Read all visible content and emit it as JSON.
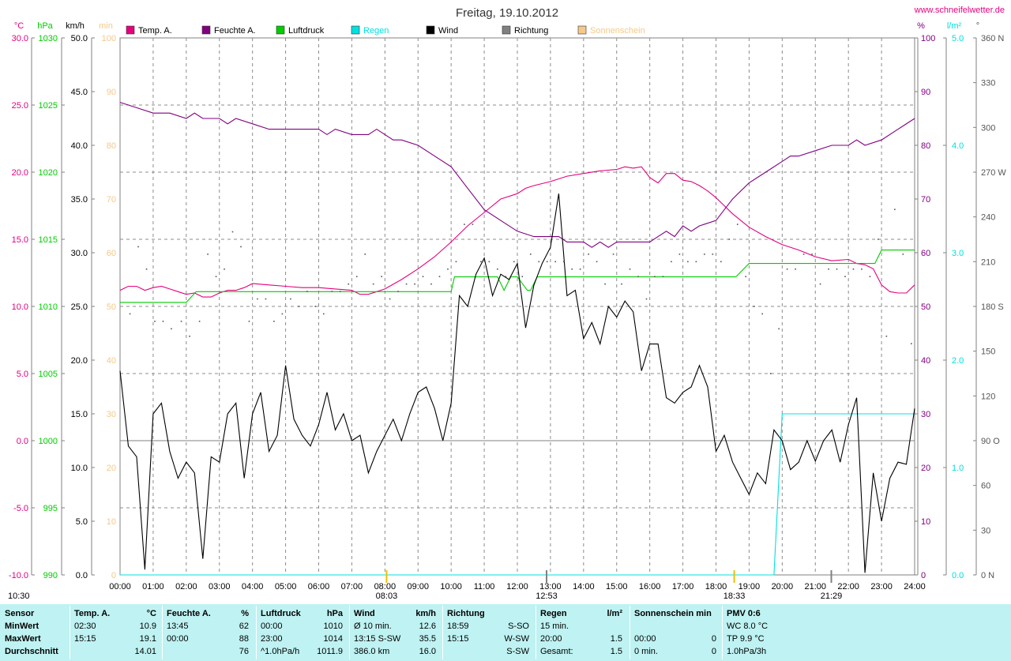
{
  "page": {
    "title": "Freitag, 19.10.2012",
    "site": "www.schneifelwetter.de",
    "left_corner": "10:30",
    "colors": {
      "temperature": "#e6007e",
      "humidity": "#800080",
      "pressure": "#00cc00",
      "rain": "#00e0e0",
      "wind": "#000000",
      "direction": "#666666",
      "sunshine": "#f5c98a",
      "stats_bg": "#bff2f2"
    }
  },
  "axes": {
    "temp": {
      "unit": "°C",
      "ticks": [
        "30.0",
        "25.0",
        "20.0",
        "15.0",
        "10.0",
        "5.0",
        "0.0",
        "-5.0",
        "-10.0"
      ],
      "range": [
        -10,
        30
      ]
    },
    "pressure": {
      "unit": "hPa",
      "ticks": [
        "1030",
        "1025",
        "1020",
        "1015",
        "1010",
        "1005",
        "1000",
        "995",
        "990"
      ],
      "range": [
        990,
        1030
      ]
    },
    "wind": {
      "unit": "km/h",
      "ticks": [
        "50.0",
        "45.0",
        "40.0",
        "35.0",
        "30.0",
        "25.0",
        "20.0",
        "15.0",
        "10.0",
        "5.0",
        "0.0"
      ],
      "range": [
        0,
        50
      ]
    },
    "sunshine": {
      "unit": "min",
      "ticks": [
        "100",
        "90",
        "80",
        "70",
        "60",
        "50",
        "40",
        "30",
        "20",
        "10",
        "0"
      ],
      "range": [
        0,
        100
      ]
    },
    "humidity": {
      "unit": "%",
      "ticks": [
        "100",
        "90",
        "80",
        "70",
        "60",
        "50",
        "40",
        "30",
        "20",
        "10",
        "0"
      ],
      "range": [
        0,
        100
      ]
    },
    "rain": {
      "unit": "l/m²",
      "ticks": [
        "5.0",
        "4.0",
        "3.0",
        "2.0",
        "1.0",
        "0.0"
      ],
      "range": [
        0,
        5
      ]
    },
    "direction": {
      "unit": "°",
      "ticks": [
        "360 N",
        "330",
        "300",
        "270 W",
        "240",
        "210",
        "180 S",
        "150",
        "120",
        "90  O",
        "60",
        "30",
        "0 N"
      ],
      "range": [
        0,
        360
      ]
    },
    "x": {
      "ticks": [
        "00:00",
        "01:00",
        "02:00",
        "03:00",
        "04:00",
        "05:00",
        "06:00",
        "07:00",
        "08:00",
        "09:00",
        "10:00",
        "11:00",
        "12:00",
        "13:00",
        "14:00",
        "15:00",
        "16:00",
        "17:00",
        "18:00",
        "19:00",
        "20:00",
        "21:00",
        "22:00",
        "23:00",
        "24:00"
      ],
      "range": [
        0,
        24
      ]
    }
  },
  "legend": [
    {
      "label": "Temp. A.",
      "color": "#e6007e"
    },
    {
      "label": "Feuchte A.",
      "color": "#800080"
    },
    {
      "label": "Luftdruck",
      "color": "#00cc00"
    },
    {
      "label": "Regen",
      "color": "#00e0e0"
    },
    {
      "label": "Wind",
      "color": "#000000"
    },
    {
      "label": "Richtung",
      "color": "#808080"
    },
    {
      "label": "Sonnenschein",
      "color": "#f5c98a"
    }
  ],
  "events": {
    "sunrise": "08:03",
    "noon": "12:53",
    "sunset": "18:33",
    "moon": "21:29"
  },
  "chart_data": {
    "type": "line",
    "title": "Freitag, 19.10.2012",
    "x_unit": "hour",
    "xlim": [
      0,
      24
    ],
    "series": [
      {
        "name": "Temp. A.",
        "axis": "°C",
        "x": [
          0,
          0.25,
          0.5,
          0.75,
          1,
          1.25,
          1.5,
          1.75,
          2,
          2.25,
          2.5,
          2.75,
          3,
          3.25,
          3.5,
          3.75,
          4,
          4.5,
          5,
          5.5,
          6,
          6.5,
          7,
          7.25,
          7.5,
          7.75,
          8,
          8.5,
          9,
          9.5,
          10,
          10.5,
          11,
          11.5,
          12,
          12.25,
          12.5,
          13,
          13.5,
          14,
          14.5,
          15,
          15.25,
          15.5,
          15.75,
          16,
          16.25,
          16.5,
          16.75,
          17,
          17.25,
          17.5,
          17.75,
          18,
          18.25,
          18.5,
          19,
          19.5,
          20,
          20.5,
          21,
          21.5,
          22,
          22.25,
          22.5,
          22.75,
          23,
          23.25,
          23.5,
          23.75,
          24
        ],
        "values": [
          11.2,
          11.5,
          11.5,
          11.2,
          11.4,
          11.5,
          11.3,
          11.1,
          10.9,
          11.0,
          10.7,
          10.7,
          11.0,
          11.2,
          11.2,
          11.4,
          11.7,
          11.6,
          11.5,
          11.4,
          11.4,
          11.3,
          11.2,
          10.9,
          10.9,
          11.1,
          11.3,
          12.0,
          12.8,
          13.7,
          14.8,
          16.0,
          17.0,
          18.0,
          18.4,
          18.8,
          19.0,
          19.3,
          19.7,
          19.9,
          20.1,
          20.2,
          20.4,
          20.3,
          20.4,
          19.6,
          19.2,
          19.9,
          19.9,
          19.4,
          19.3,
          19.0,
          18.6,
          18.1,
          17.5,
          16.9,
          15.9,
          15.2,
          14.6,
          14.2,
          13.7,
          13.4,
          13.5,
          13.2,
          13.1,
          12.8,
          11.6,
          11.1,
          11.0,
          11.0,
          11.6
        ]
      },
      {
        "name": "Feuchte A.",
        "axis": "%",
        "x": [
          0,
          0.5,
          1,
          1.5,
          2,
          2.25,
          2.5,
          3,
          3.25,
          3.5,
          4,
          4.5,
          5,
          5.5,
          6,
          6.25,
          6.5,
          7,
          7.5,
          7.75,
          8,
          8.25,
          8.5,
          9,
          9.5,
          10,
          10.5,
          11,
          11.5,
          12,
          12.5,
          13,
          13.25,
          13.5,
          13.75,
          14,
          14.25,
          14.5,
          14.75,
          15,
          15.5,
          16,
          16.25,
          16.5,
          16.75,
          17,
          17.25,
          17.5,
          18,
          18.25,
          18.5,
          19,
          19.5,
          20,
          20.25,
          20.5,
          21,
          21.5,
          22,
          22.25,
          22.5,
          23,
          23.5,
          24
        ],
        "values": [
          88,
          87,
          86,
          86,
          85,
          86,
          85,
          85,
          84,
          85,
          84,
          83,
          83,
          83,
          83,
          82,
          83,
          82,
          82,
          83,
          82,
          81,
          81,
          80,
          78,
          76,
          72,
          68,
          66,
          64,
          63,
          63,
          63,
          62,
          62,
          62,
          61,
          62,
          61,
          62,
          62,
          62,
          63,
          64,
          63,
          65,
          64,
          65,
          66,
          68,
          70,
          73,
          75,
          77,
          78,
          78,
          79,
          80,
          80,
          81,
          80,
          81,
          83,
          85
        ]
      },
      {
        "name": "Luftdruck",
        "axis": "hPa",
        "x": [
          0,
          1.4,
          2.0,
          2.3,
          4.0,
          10.0,
          10.1,
          11.4,
          11.6,
          11.8,
          12.0,
          12.3,
          12.4,
          12.6,
          18.6,
          19.0,
          22.0,
          22.4,
          22.8,
          23.0,
          24.0
        ],
        "values": [
          1010.3,
          1010.3,
          1010.3,
          1011.1,
          1011.1,
          1011.1,
          1012.2,
          1012.2,
          1011.2,
          1012.2,
          1012.2,
          1011.2,
          1011.2,
          1012.2,
          1012.2,
          1013.2,
          1013.2,
          1013.2,
          1013.2,
          1014.2,
          1014.2
        ]
      },
      {
        "name": "Regen",
        "axis": "l/m²",
        "x": [
          0,
          19.75,
          20,
          24
        ],
        "values": [
          0,
          0,
          1.5,
          1.5
        ]
      },
      {
        "name": "Wind",
        "axis": "km/h",
        "x": [
          0,
          0.25,
          0.5,
          0.75,
          1,
          1.25,
          1.5,
          1.75,
          2,
          2.25,
          2.5,
          2.75,
          3,
          3.25,
          3.5,
          3.75,
          4,
          4.25,
          4.5,
          4.75,
          5,
          5.25,
          5.5,
          5.75,
          6,
          6.25,
          6.5,
          6.75,
          7,
          7.25,
          7.5,
          7.75,
          8,
          8.25,
          8.5,
          8.75,
          9,
          9.25,
          9.5,
          9.75,
          10,
          10.25,
          10.5,
          10.75,
          11,
          11.25,
          11.5,
          11.75,
          12,
          12.25,
          12.5,
          12.75,
          13,
          13.25,
          13.5,
          13.75,
          14,
          14.25,
          14.5,
          14.75,
          15,
          15.25,
          15.5,
          15.75,
          16,
          16.25,
          16.5,
          16.75,
          17,
          17.25,
          17.5,
          17.75,
          18,
          18.25,
          18.5,
          18.75,
          19,
          19.25,
          19.5,
          19.75,
          20,
          20.25,
          20.5,
          20.75,
          21,
          21.25,
          21.5,
          21.75,
          22,
          22.25,
          22.5,
          22.75,
          23,
          23.25,
          23.5,
          23.75,
          24
        ],
        "values": [
          19,
          12,
          11,
          0.5,
          15,
          16,
          11.5,
          9,
          10.5,
          9.5,
          1.5,
          11,
          10.5,
          15,
          16,
          9,
          15,
          17,
          11.5,
          13,
          19.5,
          14.5,
          13,
          12,
          14,
          17,
          13.5,
          15,
          12.5,
          13,
          9.5,
          11.5,
          13,
          14.5,
          12.5,
          15,
          17,
          17.5,
          15.5,
          12.5,
          16,
          26,
          25,
          28,
          29.5,
          26,
          28,
          27.5,
          29,
          23,
          27,
          29,
          30.5,
          35.5,
          26,
          26.5,
          22,
          23.5,
          21.5,
          25,
          24,
          25.5,
          24.5,
          19,
          21.5,
          21.5,
          16.5,
          16,
          17,
          17.5,
          19.5,
          17.5,
          11.5,
          13,
          10.5,
          9,
          7.5,
          9.5,
          8.5,
          13.5,
          12.5,
          9.8,
          10.5,
          12.5,
          10.6,
          12.5,
          13.5,
          10.5,
          14,
          16.5,
          0.2,
          9.5,
          5,
          9,
          10.5,
          10.3,
          15.5
        ]
      },
      {
        "name": "Richtung",
        "axis": "°",
        "style": "points",
        "x": [
          0.3,
          0.55,
          0.8,
          1.05,
          1.3,
          1.55,
          1.85,
          2.1,
          2.4,
          2.65,
          2.9,
          3.15,
          3.4,
          3.65,
          3.9,
          4.15,
          4.4,
          4.65,
          4.9,
          5.15,
          5.4,
          5.65,
          5.9,
          6.15,
          6.4,
          6.65,
          6.9,
          7.15,
          7.4,
          7.65,
          7.9,
          8.15,
          8.4,
          8.65,
          8.9,
          9.15,
          9.4,
          9.65,
          9.9,
          10.15,
          10.4,
          10.65,
          10.9,
          11.15,
          11.4,
          11.65,
          11.9,
          12.15,
          12.4,
          12.65,
          12.9,
          13.15,
          13.4,
          13.65,
          13.9,
          14.15,
          14.4,
          14.65,
          14.9,
          15.15,
          15.4,
          15.65,
          15.9,
          16.15,
          16.4,
          16.65,
          16.9,
          17.15,
          17.4,
          17.65,
          17.9,
          18.15,
          18.4,
          18.65,
          18.9,
          19.15,
          19.4,
          19.65,
          19.9,
          20.15,
          20.4,
          20.65,
          20.9,
          21.15,
          21.4,
          21.65,
          21.9,
          22.15,
          22.4,
          22.65,
          22.9,
          23.15,
          23.4,
          23.65,
          23.9
        ],
        "values": [
          175,
          220,
          205,
          170,
          170,
          165,
          170,
          160,
          170,
          215,
          200,
          205,
          230,
          220,
          170,
          185,
          185,
          170,
          175,
          185,
          180,
          190,
          180,
          175,
          190,
          190,
          195,
          200,
          215,
          195,
          200,
          185,
          190,
          195,
          195,
          200,
          195,
          200,
          205,
          210,
          235,
          235,
          210,
          210,
          205,
          200,
          210,
          200,
          215,
          210,
          210,
          210,
          210,
          205,
          205,
          215,
          210,
          195,
          215,
          195,
          205,
          200,
          185,
          200,
          200,
          210,
          215,
          210,
          210,
          215,
          215,
          210,
          225,
          235,
          200,
          180,
          175,
          135,
          165,
          205,
          205,
          215,
          215,
          195,
          205,
          205,
          200,
          205,
          205,
          200,
          225,
          160,
          245,
          215,
          155
        ]
      },
      {
        "name": "Sonnenschein",
        "axis": "min",
        "values": []
      }
    ]
  },
  "stats": {
    "columns": [
      {
        "head": [
          "Sensor"
        ],
        "rows": [
          [
            "MinWert"
          ],
          [
            "MaxWert"
          ],
          [
            "Durchschnitt"
          ]
        ],
        "bold": true
      },
      {
        "head": [
          "Temp. A.",
          "°C"
        ],
        "rows": [
          [
            "02:30",
            "10.9"
          ],
          [
            "15:15",
            "19.1"
          ],
          [
            "",
            "14.01"
          ]
        ]
      },
      {
        "head": [
          "Feuchte A.",
          "%"
        ],
        "rows": [
          [
            "13:45",
            "62"
          ],
          [
            "00:00",
            "88"
          ],
          [
            "",
            "76"
          ]
        ]
      },
      {
        "head": [
          "Luftdruck",
          "hPa"
        ],
        "rows": [
          [
            "00:00",
            "1010"
          ],
          [
            "23:00",
            "1014"
          ],
          [
            "^1.0hPa/h",
            "1011.9"
          ]
        ]
      },
      {
        "head": [
          "Wind",
          "km/h"
        ],
        "rows": [
          [
            "Ø 10 min.",
            "12.6"
          ],
          [
            "13:15  S-SW",
            "35.5"
          ],
          [
            "386.0 km",
            "16.0"
          ]
        ]
      },
      {
        "head": [
          "Richtung",
          ""
        ],
        "rows": [
          [
            "18:59",
            "S-SO"
          ],
          [
            "15:15",
            "W-SW"
          ],
          [
            "",
            "S-SW"
          ]
        ]
      },
      {
        "head": [
          "Regen",
          "l/m²"
        ],
        "rows": [
          [
            "15 min.",
            ""
          ],
          [
            "20:00",
            "1.5"
          ],
          [
            "Gesamt:",
            "1.5"
          ]
        ]
      },
      {
        "head": [
          "Sonnenschein min",
          ""
        ],
        "rows": [
          [
            "",
            ""
          ],
          [
            "00:00",
            "0"
          ],
          [
            "0 min.",
            "0"
          ]
        ]
      },
      {
        "head": [
          "PMV 0:6",
          ""
        ],
        "rows": [
          [
            "WC 8.0 °C",
            ""
          ],
          [
            "TP 9.9 °C",
            ""
          ],
          [
            "1.0hPa/3h",
            ""
          ]
        ]
      }
    ]
  }
}
